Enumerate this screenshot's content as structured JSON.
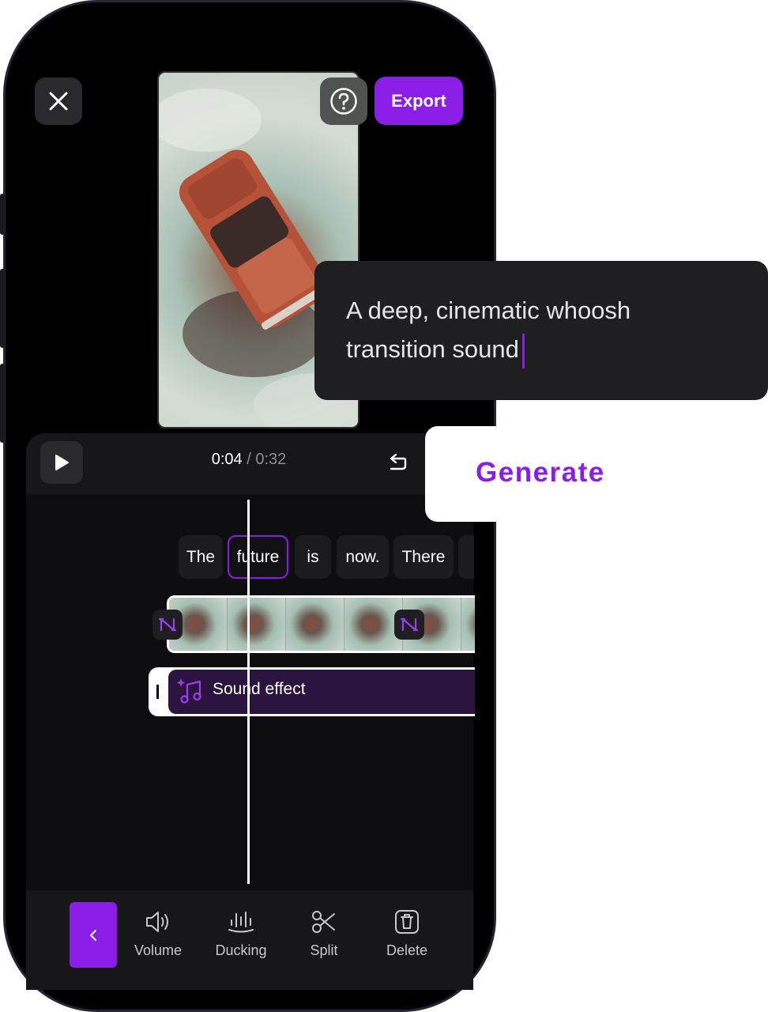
{
  "header": {
    "export_label": "Export"
  },
  "player": {
    "current_time": "0:04",
    "separator": " / ",
    "total_time": "0:32"
  },
  "transcript": {
    "words": [
      "The",
      "future",
      "is",
      "now.",
      "There"
    ]
  },
  "sound_track": {
    "label": "Sound effect"
  },
  "toolbar": {
    "items": [
      {
        "label": "Volume",
        "icon": "volume-icon"
      },
      {
        "label": "Ducking",
        "icon": "ducking-icon"
      },
      {
        "label": "Split",
        "icon": "scissors-icon"
      },
      {
        "label": "Delete",
        "icon": "trash-icon"
      }
    ]
  },
  "prompt": {
    "line1": "A deep, cinematic whoosh",
    "line2": "transition sound"
  },
  "generate": {
    "label": "Generate"
  },
  "colors": {
    "accent": "#8a1ee6",
    "track_fill": "#2b1540",
    "panel": "#17171a"
  }
}
